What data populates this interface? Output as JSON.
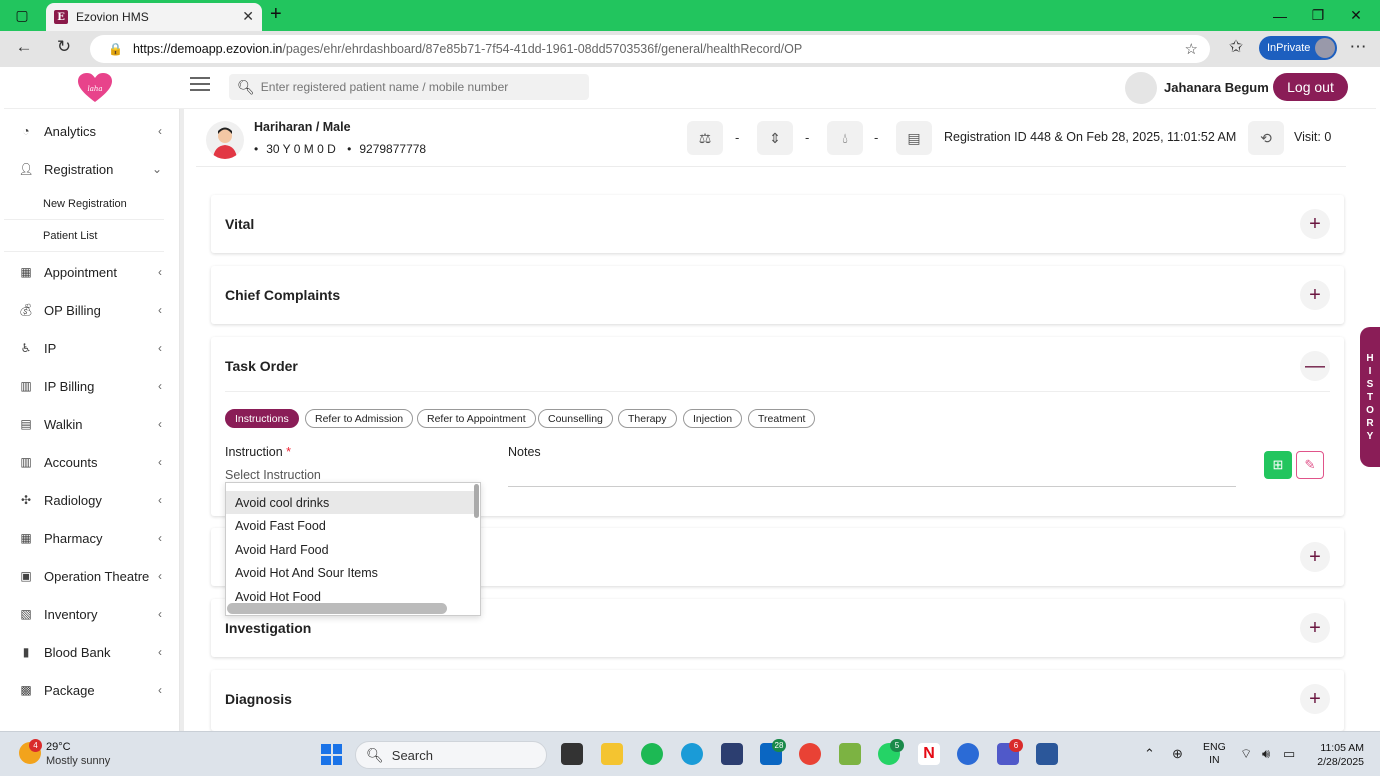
{
  "browser": {
    "tab_title": "Ezovion HMS",
    "tab_favicon_letter": "E",
    "url_host": "https://demoapp.ezovion.in",
    "url_path": "/pages/ehr/ehrdashboard/87e85b71-7f54-41dd-1961-08dd5703536f/general/healthRecord/OP",
    "inprivate_label": "InPrivate"
  },
  "header": {
    "logo_text": "laha",
    "search_placeholder": "Enter registered patient name / mobile number",
    "user_name": "Jahanara Begum",
    "logout_label": "Log out"
  },
  "sidebar": {
    "items": [
      {
        "label": "Analytics",
        "icon": "chart-pie-icon"
      },
      {
        "label": "Registration",
        "icon": "user-add-icon"
      },
      {
        "label": "Appointment",
        "icon": "calendar-icon"
      },
      {
        "label": "OP Billing",
        "icon": "money-icon"
      },
      {
        "label": "IP",
        "icon": "walker-icon"
      },
      {
        "label": "IP Billing",
        "icon": "receipt-icon"
      },
      {
        "label": "Walkin",
        "icon": "clipboard-icon"
      },
      {
        "label": "Accounts",
        "icon": "bank-icon"
      },
      {
        "label": "Radiology",
        "icon": "radiation-icon"
      },
      {
        "label": "Pharmacy",
        "icon": "pharmacy-icon"
      },
      {
        "label": "Operation Theatre",
        "icon": "ot-icon"
      },
      {
        "label": "Inventory",
        "icon": "inventory-icon"
      },
      {
        "label": "Blood Bank",
        "icon": "blood-icon"
      },
      {
        "label": "Package",
        "icon": "package-icon"
      }
    ],
    "sub_items": [
      {
        "label": "New Registration"
      },
      {
        "label": "Patient List"
      }
    ]
  },
  "patient": {
    "name_gender": "Hariharan / Male",
    "age": "30 Y 0 M 0 D",
    "phone": "9279877778",
    "vital_dash_1": "-",
    "vital_dash_2": "-",
    "vital_dash_3": "-",
    "registration": "Registration ID 448 & On Feb 28, 2025, 11:01:52 AM",
    "visit": "Visit: 0"
  },
  "cards": {
    "vital": "Vital",
    "chief_complaints": "Chief Complaints",
    "task_order": "Task Order",
    "investigation": "Investigation",
    "diagnosis": "Diagnosis"
  },
  "task_order": {
    "tabs": [
      {
        "label": "Instructions",
        "active": true
      },
      {
        "label": "Refer to Admission",
        "active": false
      },
      {
        "label": "Refer to Appointment",
        "active": false
      },
      {
        "label": "Counselling",
        "active": false
      },
      {
        "label": "Therapy",
        "active": false
      },
      {
        "label": "Injection",
        "active": false
      },
      {
        "label": "Treatment",
        "active": false
      }
    ],
    "instruction_label": "Instruction",
    "required_mark": "*",
    "select_placeholder": "Select Instruction",
    "notes_label": "Notes",
    "dropdown_options": [
      "Avoid cool drinks",
      "Avoid Fast Food",
      "Avoid Hard Food",
      "Avoid Hot And Sour Items",
      "Avoid Hot Food"
    ]
  },
  "history_tab": [
    "H",
    "I",
    "S",
    "T",
    "O",
    "R",
    "Y"
  ],
  "taskbar": {
    "weather_badge": "4",
    "temperature": "29°C",
    "weather_desc": "Mostly sunny",
    "search_label": "Search",
    "badge_linkedin": "28",
    "badge_whatsapp": "5",
    "badge_teams": "6",
    "lang_line1": "ENG",
    "lang_line2": "IN",
    "time": "11:05 AM",
    "date": "2/28/2025"
  },
  "colors": {
    "brand": "#8a1d57",
    "tabbar": "#22c55e",
    "save": "#22c55e"
  }
}
